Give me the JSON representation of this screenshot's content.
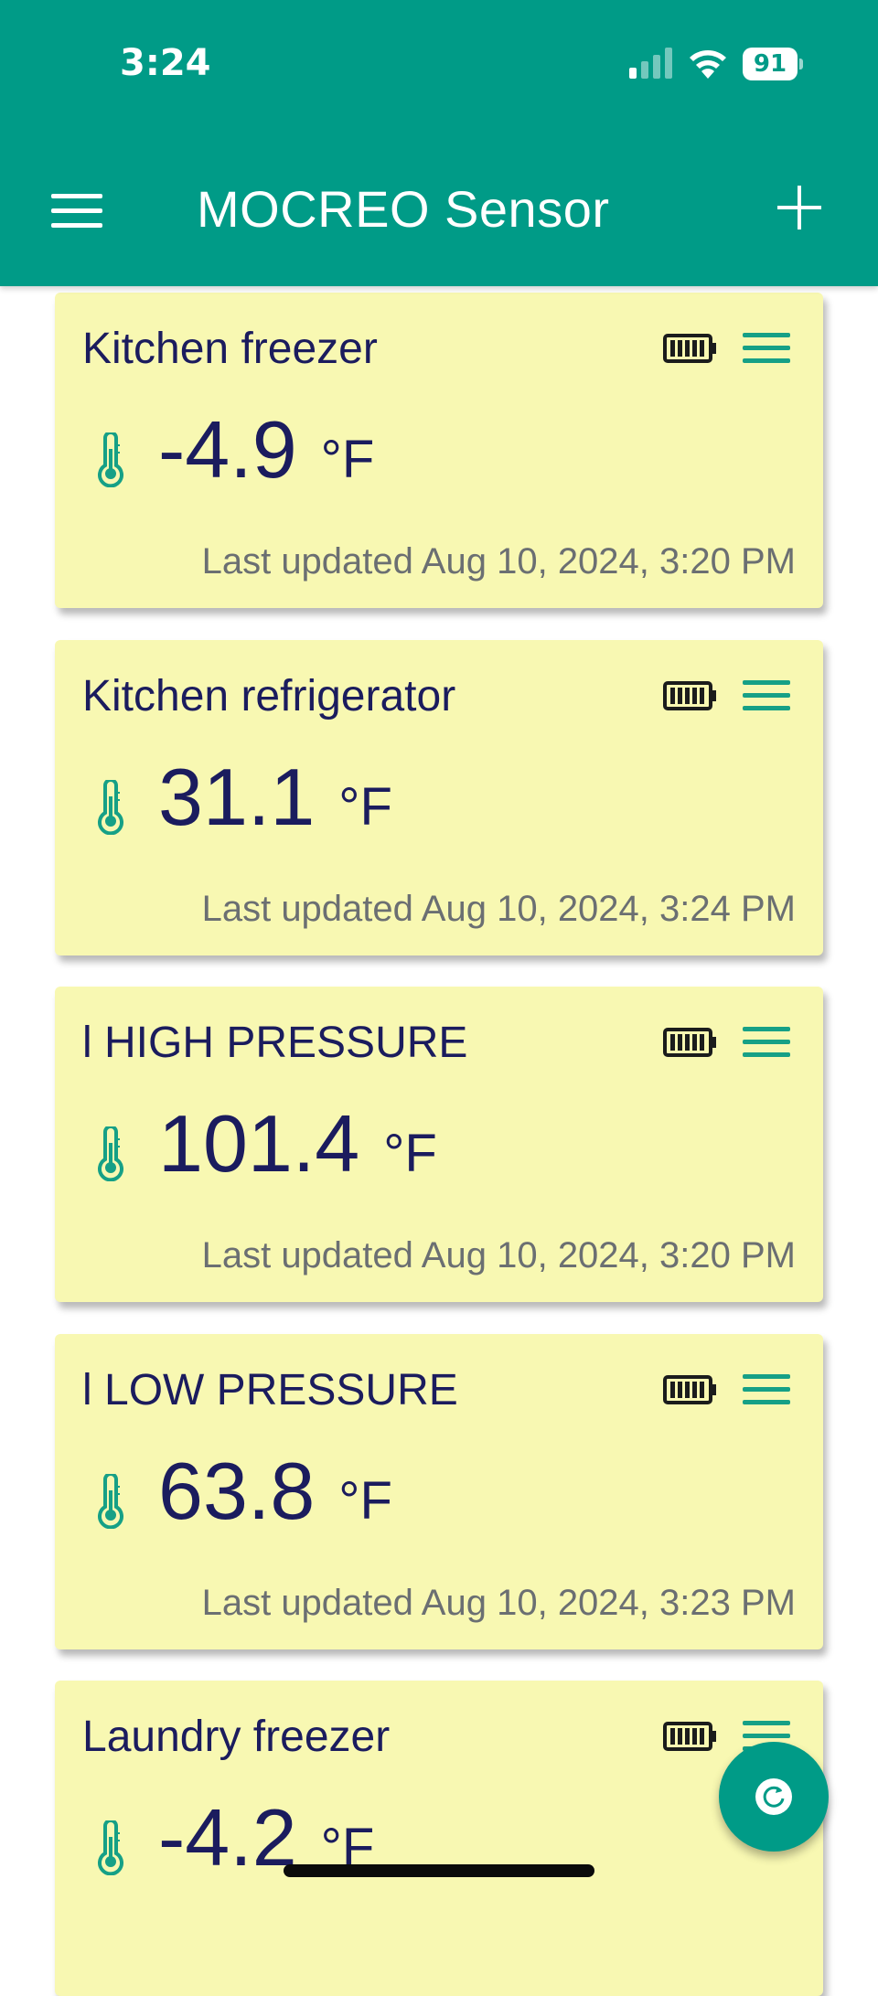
{
  "status_bar": {
    "time": "3:24",
    "battery_percent": "91"
  },
  "header": {
    "title": "MOCREO Sensor",
    "menu_icon": "hamburger-menu-icon",
    "add_icon": "plus-icon"
  },
  "colors": {
    "header_bg": "#009b87",
    "card_bg": "#f8f8b2",
    "text_dark": "#1b1c5e",
    "accent": "#16a086",
    "muted": "#6b6f72"
  },
  "sensors": [
    {
      "name": "Kitchen freezer",
      "temperature": "-4.9",
      "unit": "°F",
      "updated": "Last updated Aug 10, 2024, 3:20 PM",
      "battery_icon": "battery-full-icon"
    },
    {
      "name": "Kitchen refrigerator",
      "temperature": "31.1",
      "unit": "°F",
      "updated": "Last updated Aug 10, 2024, 3:24 PM",
      "battery_icon": "battery-full-icon"
    },
    {
      "name": "l HIGH PRESSURE",
      "temperature": "101.4",
      "unit": "°F",
      "updated": "Last updated Aug 10, 2024, 3:20 PM",
      "battery_icon": "battery-full-icon"
    },
    {
      "name": "l LOW PRESSURE",
      "temperature": "63.8",
      "unit": "°F",
      "updated": "Last updated Aug 10, 2024, 3:23 PM",
      "battery_icon": "battery-full-icon"
    },
    {
      "name": "Laundry freezer",
      "temperature": "-4.2",
      "unit": "°F",
      "updated": "",
      "battery_icon": "battery-full-icon"
    }
  ],
  "fab": {
    "icon": "refresh-icon"
  }
}
